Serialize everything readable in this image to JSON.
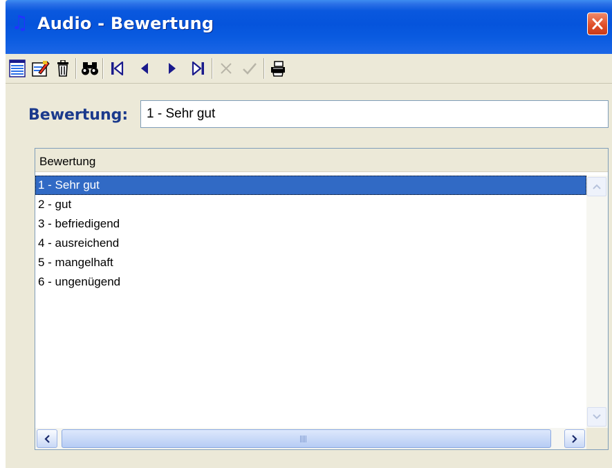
{
  "window": {
    "title": "Audio - Bewertung",
    "title_icon": "music-note-icon",
    "title_icon_glyph": "♫",
    "colors": {
      "titlebar": "#0554dc",
      "selection": "#316ac5",
      "label": "#1b3a8c",
      "close": "#e0502a"
    }
  },
  "toolbar": {
    "buttons": [
      {
        "name": "new-record",
        "icon": "list-icon"
      },
      {
        "name": "edit-record",
        "icon": "edit-icon"
      },
      {
        "name": "delete-record",
        "icon": "trash-icon"
      },
      {
        "name": "search",
        "icon": "binoculars-icon"
      },
      {
        "name": "first-record",
        "icon": "first-icon"
      },
      {
        "name": "previous-record",
        "icon": "previous-icon"
      },
      {
        "name": "next-record",
        "icon": "next-icon"
      },
      {
        "name": "last-record",
        "icon": "last-icon"
      },
      {
        "name": "cancel",
        "icon": "cancel-icon",
        "disabled": true
      },
      {
        "name": "confirm",
        "icon": "check-icon",
        "disabled": true
      },
      {
        "name": "print",
        "icon": "printer-icon"
      }
    ]
  },
  "form": {
    "label": "Bewertung:",
    "value": "1 - Sehr gut"
  },
  "list": {
    "column_header": "Bewertung",
    "items": [
      "1 - Sehr gut",
      "2 - gut",
      "3 - befriedigend",
      "4 - ausreichend",
      "5 - mangelhaft",
      "6 - ungenügend"
    ],
    "selected_index": 0
  }
}
